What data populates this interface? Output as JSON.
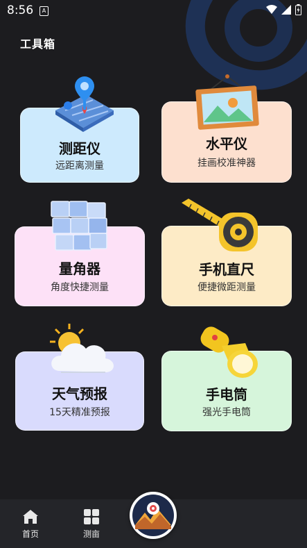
{
  "status_bar": {
    "time": "8:56",
    "a_badge": "A"
  },
  "page": {
    "title": "工具箱"
  },
  "tools": [
    {
      "title": "测距仪",
      "subtitle": "远距离测量",
      "icon": "map-pin-icon"
    },
    {
      "title": "水平仪",
      "subtitle": "挂画校准神器",
      "icon": "picture-frame-icon"
    },
    {
      "title": "量角器",
      "subtitle": "角度快捷测量",
      "icon": "cube-icon"
    },
    {
      "title": "手机直尺",
      "subtitle": "便捷微距测量",
      "icon": "tape-measure-icon"
    },
    {
      "title": "天气预报",
      "subtitle": "15天精准预报",
      "icon": "weather-icon"
    },
    {
      "title": "手电筒",
      "subtitle": "强光手电筒",
      "icon": "flashlight-icon"
    }
  ],
  "bottom_nav": [
    {
      "label": "首页",
      "icon": "home-icon"
    },
    {
      "label": "测亩",
      "icon": "grid-icon"
    }
  ],
  "fab": {
    "icon": "mountain-target-icon"
  }
}
